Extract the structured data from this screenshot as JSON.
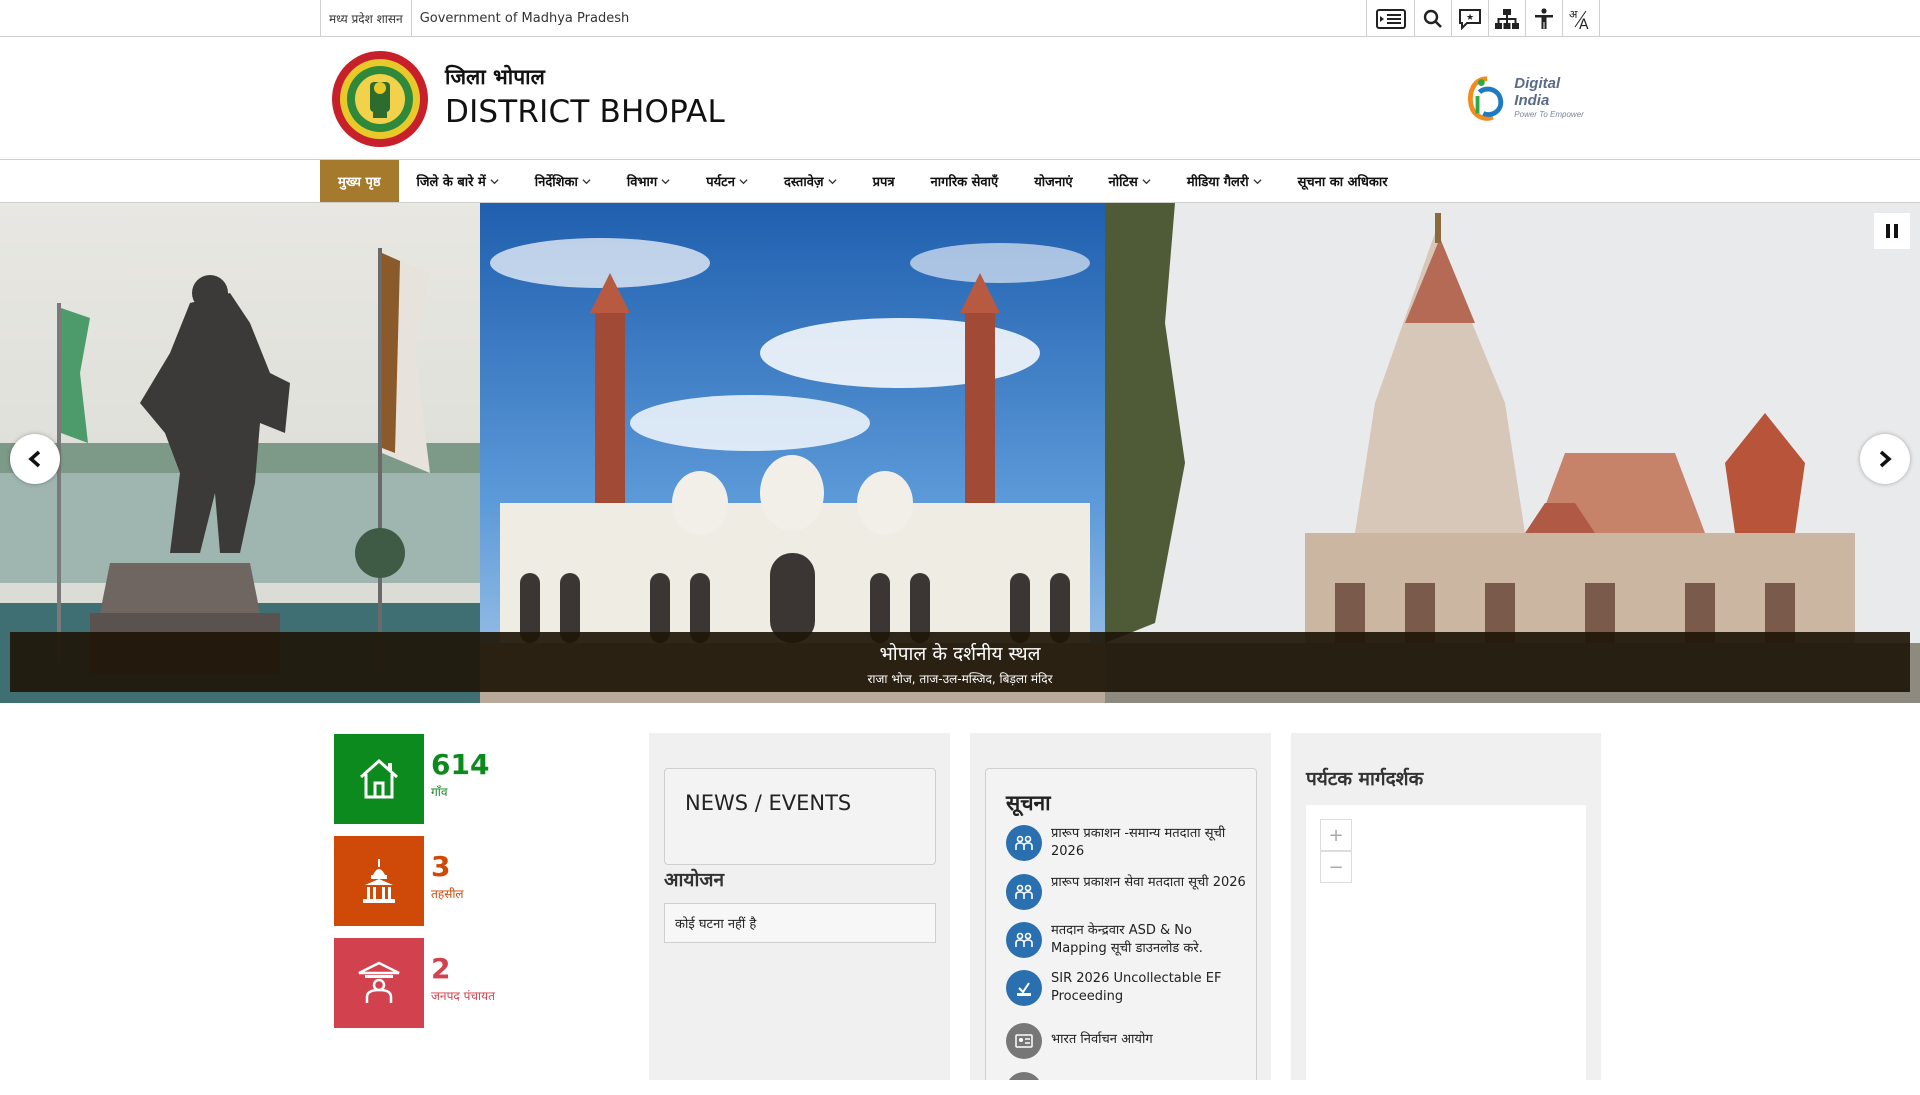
{
  "topbar": {
    "gov_hi": "मध्य प्रदेश शासन",
    "gov_en": "Government of Madhya Pradesh",
    "tools": [
      "skip-to-content-icon",
      "search-icon",
      "feedback-icon",
      "sitemap-icon",
      "accessibility-icon",
      "language-icon"
    ]
  },
  "header": {
    "title_hi": "जिला भोपाल",
    "title_en": "DISTRICT BHOPAL",
    "digital_india_title": "Digital India",
    "digital_india_sub": "Power To Empower"
  },
  "nav": {
    "items": [
      {
        "label": "मुख्य पृष्ठ",
        "dropdown": false
      },
      {
        "label": "जिले के बारे में",
        "dropdown": true
      },
      {
        "label": "निर्देशिका",
        "dropdown": true
      },
      {
        "label": "विभाग",
        "dropdown": true
      },
      {
        "label": "पर्यटन",
        "dropdown": true
      },
      {
        "label": "दस्तावेज़",
        "dropdown": true
      },
      {
        "label": "प्रपत्र",
        "dropdown": false
      },
      {
        "label": "नागरिक सेवाएँ",
        "dropdown": false
      },
      {
        "label": "योजनाएं",
        "dropdown": false
      },
      {
        "label": "नोटिस",
        "dropdown": true
      },
      {
        "label": "मीडिया गैलरी",
        "dropdown": true
      },
      {
        "label": "सूचना का अधिकार",
        "dropdown": false
      }
    ]
  },
  "slider": {
    "caption_title": "भोपाल के दर्शनीय स्थल",
    "caption_sub": "राजा भोज, ताज-उल-मस्जिद, बिड़ला मंदिर"
  },
  "stats": [
    {
      "value": "614",
      "label": "गाँव",
      "color": "#0c8a1e"
    },
    {
      "value": "3",
      "label": "तहसील",
      "color": "#cf4a08"
    },
    {
      "value": "2",
      "label": "जनपद पंचायत",
      "color": "#d2424e"
    }
  ],
  "news": {
    "title": "NEWS / EVENTS",
    "events_heading": "आयोजन",
    "events_empty": "कोई घटना नहीं है"
  },
  "suchna": {
    "title": "सूचना",
    "items": [
      {
        "text": "प्रारूप प्रकाशन -समान्य मतदाता सूची 2026"
      },
      {
        "text": "प्रारूप प्रकाशन सेवा मतदाता सूची 2026"
      },
      {
        "text": "मतदान केन्द्रवार ASD & No Mapping सूची डाउनलोड करे."
      },
      {
        "text": "SIR 2026 Uncollectable EF Proceeding"
      },
      {
        "text": "भारत निर्वाचन आयोग"
      }
    ]
  },
  "tourist": {
    "title": "पर्यटक मार्गदर्शक",
    "zoom_in": "+",
    "zoom_out": "−"
  },
  "colors": {
    "nav_active": "#a57a2c",
    "notice_icon": "#2a6fb0"
  }
}
